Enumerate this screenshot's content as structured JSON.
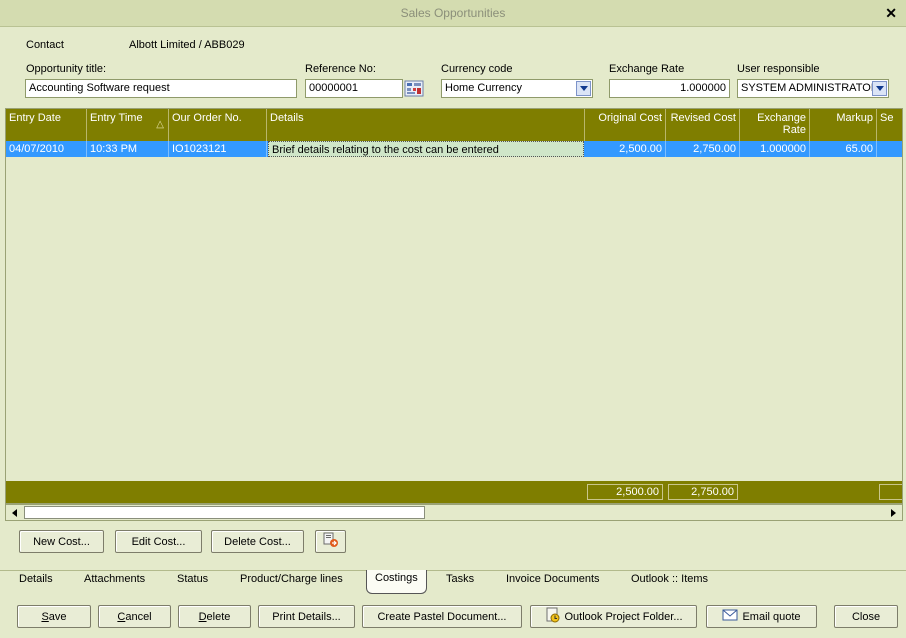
{
  "window": {
    "title": "Sales Opportunities"
  },
  "header": {
    "contact_label": "Contact",
    "contact_value": "Albott Limited / ABB029",
    "title_label": "Opportunity title:",
    "title_value": "Accounting Software request",
    "ref_label": "Reference No:",
    "ref_value": "00000001",
    "currency_label": "Currency code",
    "currency_value": "Home Currency",
    "rate_label": "Exchange Rate",
    "rate_value": "1.000000",
    "user_label": "User responsible",
    "user_value": "SYSTEM ADMINISTRATOI"
  },
  "grid": {
    "columns": [
      "Entry Date",
      "Entry Time",
      "Our Order No.",
      "Details",
      "Original Cost",
      "Revised Cost",
      "Exchange Rate",
      "Markup",
      "Se"
    ],
    "rows": [
      {
        "entry_date": "04/07/2010",
        "entry_time": "10:33 PM",
        "order_no": "IO1023121",
        "details": "Brief details relating to the cost can be entered",
        "original_cost": "2,500.00",
        "revised_cost": "2,750.00",
        "exchange_rate": "1.000000",
        "markup": "65.00"
      }
    ],
    "totals": {
      "original_cost": "2,500.00",
      "revised_cost": "2,750.00"
    },
    "sort_indicator": "△"
  },
  "cost_buttons": {
    "new": "New Cost...",
    "edit": "Edit Cost...",
    "delete": "Delete Cost..."
  },
  "tabs": [
    "Details",
    "Attachments",
    "Status",
    "Product/Charge lines",
    "Costings",
    "Tasks",
    "Invoice Documents",
    "Outlook :: Items"
  ],
  "active_tab": "Costings",
  "footer": {
    "save_rest": "ave",
    "save_u": "S",
    "cancel_rest": "ancel",
    "cancel_u": "C",
    "delete_rest": "elete",
    "delete_u": "D",
    "print": "Print Details...",
    "pastel": "Create Pastel Document...",
    "outlook": "Outlook Project Folder...",
    "email": "Email quote",
    "close": "Close"
  },
  "colors": {
    "header": "#7f7e00",
    "selection": "#3399ff",
    "background": "#e4eacb"
  }
}
